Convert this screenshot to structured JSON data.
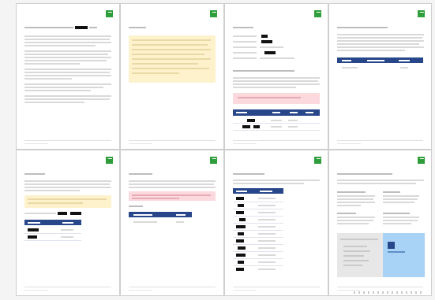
{
  "pages": [
    {
      "title": "",
      "accent": "#27478a"
    },
    {
      "title": "",
      "accent": "#fdf2cc"
    },
    {
      "title": "",
      "accent": "#fbd9dd"
    },
    {
      "title": "",
      "accent": "#27478a"
    },
    {
      "title": "",
      "accent": "#fdf2cc"
    },
    {
      "title": "",
      "accent": "#fbd9dd"
    },
    {
      "title": "",
      "accent": "#27478a"
    },
    {
      "title": "",
      "accent": "#a9d3f6"
    }
  ],
  "colors": {
    "logo": "#2e9e3a",
    "table_header": "#27478a",
    "note_box": "#fdf2cc",
    "warning_box": "#fbd9dd",
    "info_panel": "#a9d3f6"
  }
}
